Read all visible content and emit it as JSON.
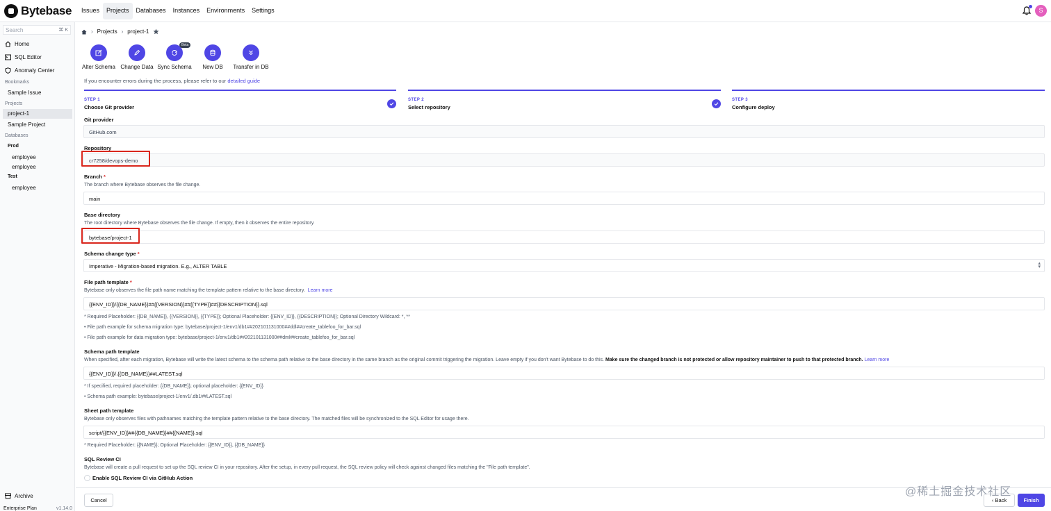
{
  "app": {
    "name": "Bytebase"
  },
  "nav": [
    "Issues",
    "Projects",
    "Databases",
    "Instances",
    "Environments",
    "Settings"
  ],
  "user": {
    "avatar_initial": "S",
    "accent": "#e45fbd"
  },
  "sidebar": {
    "search_placeholder": "Search",
    "search_shortcut": "⌘ K",
    "items": [
      {
        "label": "Home",
        "icon": "home-icon"
      },
      {
        "label": "SQL Editor",
        "icon": "terminal-icon"
      },
      {
        "label": "Anomaly Center",
        "icon": "shield-icon"
      }
    ],
    "bookmarks_heading": "Bookmarks",
    "bookmarks": [
      "Sample Issue"
    ],
    "projects_heading": "Projects",
    "projects": [
      "project-1",
      "Sample Project"
    ],
    "databases_heading": "Databases",
    "env_prod": "Prod",
    "prod_dbs": [
      "employee",
      "employee"
    ],
    "env_test": "Test",
    "test_dbs": [
      "employee"
    ],
    "archive": "Archive",
    "plan": "Enterprise Plan",
    "version": "v1.14.0"
  },
  "breadcrumb": {
    "projects": "Projects",
    "current": "project-1"
  },
  "actions": [
    {
      "label": "Alter Schema",
      "icon": "edit-square-icon"
    },
    {
      "label": "Change Data",
      "icon": "pencil-icon"
    },
    {
      "label": "Sync Schema",
      "icon": "sync-icon",
      "badge": "Beta"
    },
    {
      "label": "New DB",
      "icon": "database-icon"
    },
    {
      "label": "Transfer in DB",
      "icon": "chevrons-down-icon"
    }
  ],
  "guide": {
    "text": "If you encounter errors during the process, please refer to our ",
    "link": "detailed guide"
  },
  "steps": [
    {
      "num": "STEP 1",
      "name": "Choose Git provider",
      "done": true
    },
    {
      "num": "STEP 2",
      "name": "Select repository",
      "done": true
    },
    {
      "num": "STEP 3",
      "name": "Configure deploy",
      "done": false
    }
  ],
  "form": {
    "git_provider": {
      "label": "Git provider",
      "value": "GitHub.com"
    },
    "repository": {
      "label": "Repository",
      "value": "cr7258/devops-demo"
    },
    "branch": {
      "label": "Branch",
      "desc": "The branch where Bytebase observes the file change.",
      "value": "main"
    },
    "base_directory": {
      "label": "Base directory",
      "desc": "The root directory where Bytebase observes the file change. If empty, then it observes the entire repository.",
      "value": "bytebase/project-1"
    },
    "schema_change_type": {
      "label": "Schema change type",
      "value": "Imperative - Migration-based migration. E.g., ALTER TABLE"
    },
    "file_path_template": {
      "label": "File path template",
      "desc": "Bytebase only observes the file path name matching the template pattern relative to the base directory.",
      "link": "Learn more",
      "value": "{{ENV_ID}}/{{DB_NAME}}##{{VERSION}}##{{TYPE}}##{{DESCRIPTION}}.sql",
      "note1": "* Required Placeholder: {{DB_NAME}}, {{VERSION}}, {{TYPE}}; Optional Placeholder: {{ENV_ID}}, {{DESCRIPTION}}; Optional Directory Wildcard: *, **",
      "note2": "• File path example for schema migration type: bytebase/project-1/env1/db1##202101131000##ddl##create_tablefoo_for_bar.sql",
      "note3": "• File path example for data migration type: bytebase/project-1/env1/db1##202101131000##dml##create_tablefoo_for_bar.sql"
    },
    "schema_path_template": {
      "label": "Schema path template",
      "desc": "When specified, after each migration, Bytebase will write the latest schema to the schema path relative to the base directory in the same branch as the original commit triggering the migration. Leave empty if you don't want Bytebase to do this. ",
      "desc_bold": "Make sure the changed branch is not protected or allow repository maintainer to push to that protected branch.",
      "link": "Learn more",
      "value": "{{ENV_ID}}/.{{DB_NAME}}##LATEST.sql",
      "note1": "* If specified,  required placeholder: {{DB_NAME}}; optional placeholder: {{ENV_ID}}",
      "note2": "• Schema path example: bytebase/project-1/env1/.db1##LATEST.sql"
    },
    "sheet_path_template": {
      "label": "Sheet path template",
      "desc": "Bytebase only observes files with pathnames matching the template pattern relative to the base directory. The matched files will be synchronized to the SQL Editor for usage there.",
      "value": "script/{{ENV_ID}}##{{DB_NAME}}##{{NAME}}.sql",
      "note1": "* Required Placeholder: {{NAME}}; Optional Placeholder: {{ENV_ID}}, {{DB_NAME}}"
    },
    "sql_review": {
      "label": "SQL Review CI",
      "desc": "Bytebase will create a pull request to set up the SQL review CI in your repository. After the setup, in every pull request, the SQL review policy will check against changed files matching the \"File path template\".",
      "checkbox": "Enable SQL Review CI via GitHub Action"
    }
  },
  "buttons": {
    "cancel": "Cancel",
    "back": "Back",
    "finish": "Finish"
  },
  "watermark": "@稀土掘金技术社区"
}
